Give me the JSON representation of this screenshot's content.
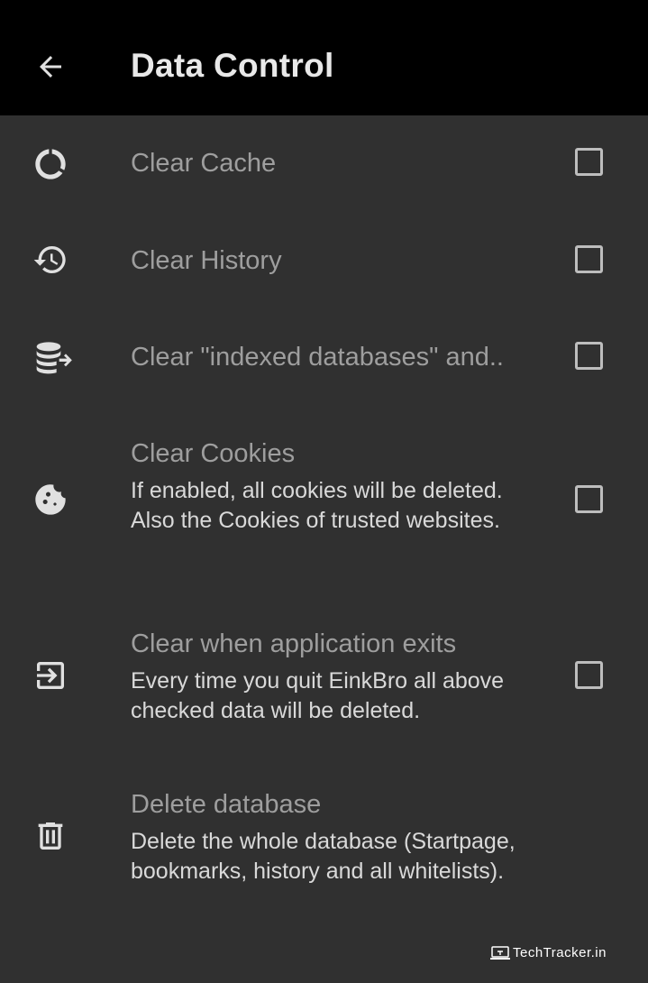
{
  "header": {
    "title": "Data Control",
    "back_icon": "arrow-left-icon"
  },
  "settings": [
    {
      "icon": "cache-icon",
      "title": "Clear Cache",
      "checked": false
    },
    {
      "icon": "history-icon",
      "title": "Clear History",
      "checked": false
    },
    {
      "icon": "database-export-icon",
      "title": "Clear \"indexed databases\" and..",
      "checked": false
    },
    {
      "icon": "cookie-icon",
      "title": "Clear Cookies",
      "summary": "If enabled, all cookies will be deleted. Also the Cookies of trusted websites.",
      "checked": false
    },
    {
      "icon": "exit-icon",
      "title": "Clear when application exits",
      "summary": "Every time you quit EinkBro all above checked data will be deleted.",
      "checked": false
    },
    {
      "icon": "trash-icon",
      "title": "Delete database",
      "summary": "Delete the whole database (Startpage, bookmarks, history and all whitelists)."
    }
  ],
  "watermark": {
    "text": "TechTracker.in"
  },
  "colors": {
    "background": "#303030",
    "app_bar": "#000000",
    "title_text": "#9e9e9e",
    "summary_text": "#d9d9d9",
    "icon": "#e0e0e0",
    "checkbox_border": "#bdbdbd"
  }
}
